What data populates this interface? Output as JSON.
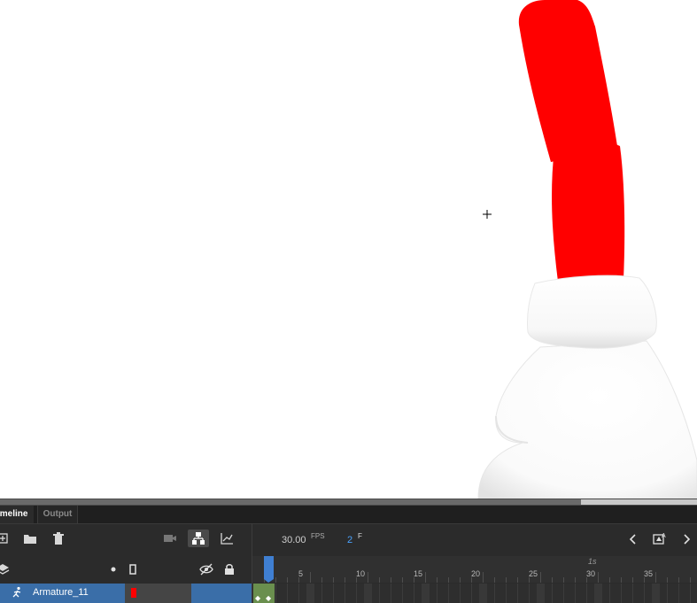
{
  "stage": {
    "colors": {
      "background": "#ffffff",
      "hat_red": "#ff0000",
      "hat_trim": "#f4f4f4"
    }
  },
  "panel": {
    "tabs": [
      {
        "label": "imeline"
      },
      {
        "label": "Output"
      }
    ],
    "toolbar": {
      "fps_value": "30.00",
      "fps_unit": "FPS",
      "frame_value": "2",
      "frame_unit": "F"
    },
    "ruler": {
      "labels": [
        "5",
        "10",
        "15",
        "20",
        "25",
        "30",
        "35"
      ],
      "seconds_label": "1s"
    },
    "layer": {
      "name": "Armature_11",
      "color": "#ff0000"
    }
  }
}
